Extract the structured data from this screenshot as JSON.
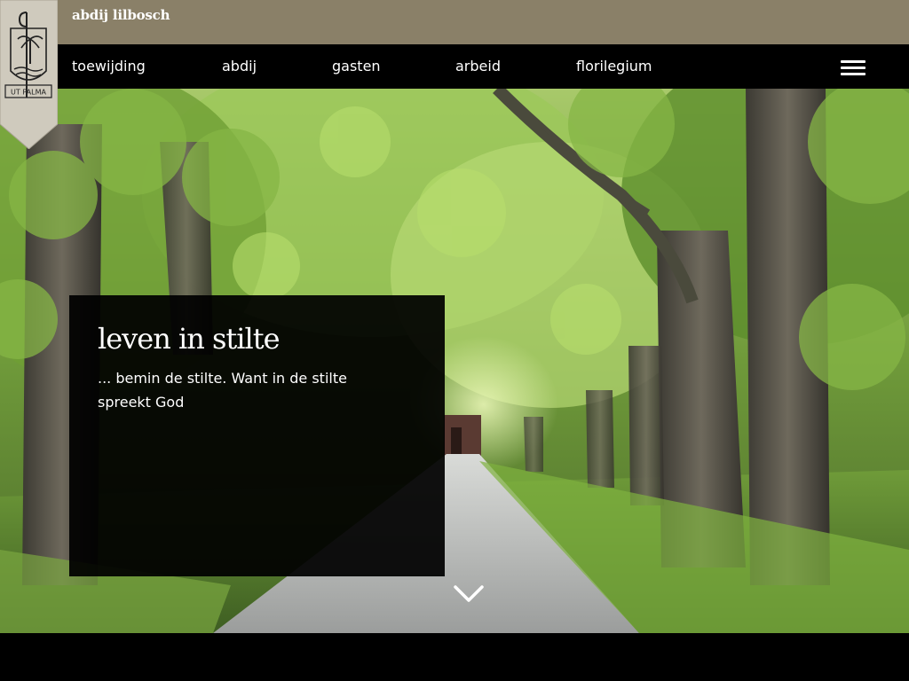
{
  "site": {
    "title": "abdij lilbosch",
    "logo_motto": "UT PALMA"
  },
  "nav": {
    "items": [
      {
        "label": "toewijding"
      },
      {
        "label": "abdij"
      },
      {
        "label": "gasten"
      },
      {
        "label": "arbeid"
      },
      {
        "label": "florilegium"
      }
    ]
  },
  "hero": {
    "title": "leven in stilte",
    "text": "... bemin de stilte. Want in de stilte spreekt God"
  },
  "icons": {
    "menu": "hamburger-menu-icon",
    "scroll": "chevron-down-icon",
    "logo": "abbey-crest-icon"
  },
  "colors": {
    "topbar": "#8a8068",
    "navbar": "#000000",
    "logo_bg": "#cfcabd"
  }
}
